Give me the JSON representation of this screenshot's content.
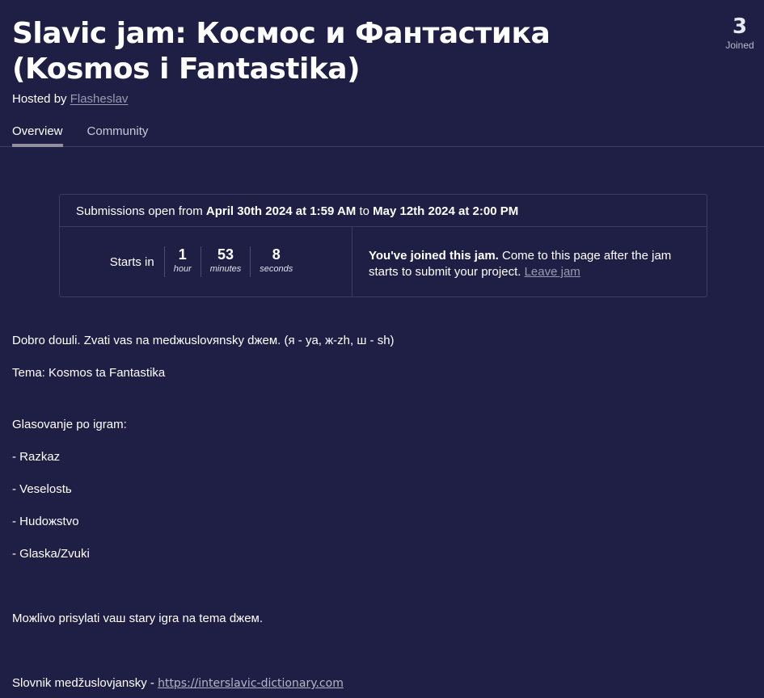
{
  "jam": {
    "title_line1": "Slavic jam: Космос и Фантастика",
    "title_line2": "(Kosmos i Fantastika)",
    "hosted_prefix": "Hosted by",
    "host": "Flasheslav",
    "joined_count": "3",
    "joined_label": "Joined"
  },
  "tabs": [
    {
      "label": "Overview",
      "active": true
    },
    {
      "label": "Community",
      "active": false
    }
  ],
  "submissions": {
    "prefix": "Submissions open from",
    "start": "April 30th 2024 at 1:59 AM",
    "middle": "to",
    "end": "May 12th 2024 at 2:00 PM"
  },
  "countdown": {
    "label": "Starts in",
    "units": [
      {
        "value": "1",
        "label": "hour"
      },
      {
        "value": "53",
        "label": "minutes"
      },
      {
        "value": "8",
        "label": "seconds"
      }
    ]
  },
  "join_status": {
    "bold": "You've joined this jam.",
    "text": "Come to this page after the jam starts to submit your project.",
    "leave_link": "Leave jam"
  },
  "description": {
    "line1": "Dobro doшli.  Zvati vas na medжuslovяnsky dжeм. (я - ya, ж-zh, ш - sh)",
    "line2": "Tema: Kosmos ta Fantastika",
    "line3": "Glasovanje po igram:",
    "items": [
      "- Razkaz",
      "- Veselostь",
      "- Hudoжstvo",
      "- Glaska/Zvuki"
    ],
    "line4": "Moжlivo prisylati vaш stary igra na tema dжeм.",
    "dict_label": "Slovnik medžuslovjansky  -",
    "dict_link": "https://interslavic-dictionary.com"
  }
}
